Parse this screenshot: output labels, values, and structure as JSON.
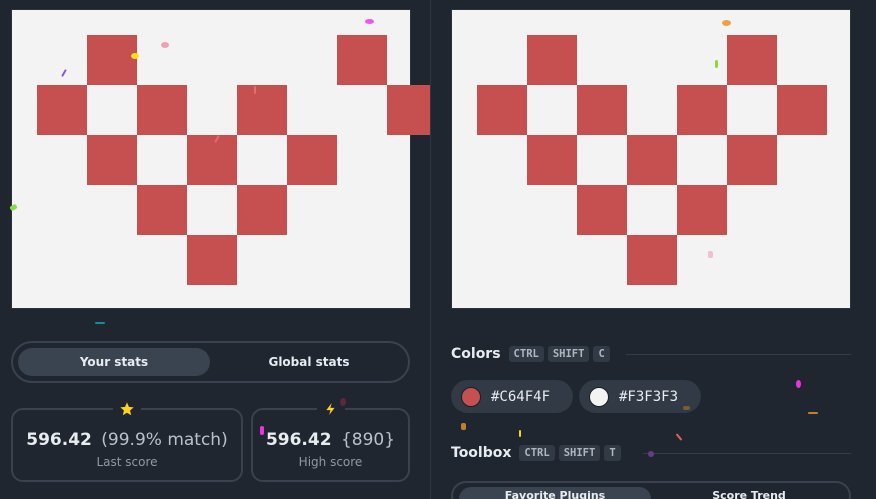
{
  "target_canvas": {
    "background": "#F3F3F3",
    "fill": "#C64F4F",
    "cells": [
      [
        2,
        1
      ],
      [
        7,
        1
      ],
      [
        1,
        2
      ],
      [
        3,
        2
      ],
      [
        5,
        2
      ],
      [
        8,
        2
      ],
      [
        2,
        3
      ],
      [
        4,
        3
      ],
      [
        6,
        3
      ],
      [
        3,
        4
      ],
      [
        5,
        4
      ],
      [
        4,
        5
      ]
    ]
  },
  "output_canvas": {
    "background": "#F3F3F3",
    "fill": "#C64F4F",
    "cells": [
      [
        2,
        1
      ],
      [
        6,
        1
      ],
      [
        1,
        2
      ],
      [
        3,
        2
      ],
      [
        5,
        2
      ],
      [
        7,
        2
      ],
      [
        2,
        3
      ],
      [
        4,
        3
      ],
      [
        6,
        3
      ],
      [
        3,
        4
      ],
      [
        5,
        4
      ],
      [
        4,
        5
      ]
    ]
  },
  "stats_tabs": {
    "your_stats": "Your stats",
    "global_stats": "Global stats"
  },
  "last_score": {
    "icon": "star-icon",
    "value": "596.42",
    "match": "(99.9% match)",
    "label": "Last score"
  },
  "high_score": {
    "icon": "lightning-icon",
    "value": "596.42",
    "count": "{890}",
    "label": "High score"
  },
  "colors_section": {
    "title": "Colors",
    "shortcut": [
      "CTRL",
      "SHIFT",
      "C"
    ],
    "swatches": [
      {
        "hex": "#C64F4F",
        "color": "#C64F4F"
      },
      {
        "hex": "#F3F3F3",
        "color": "#F3F3F3"
      }
    ]
  },
  "toolbox_section": {
    "title": "Toolbox",
    "shortcut": [
      "CTRL",
      "SHIFT",
      "T"
    ],
    "tabs": {
      "favorite_plugins": "Favorite Plugins",
      "score_trend": "Score Trend"
    }
  }
}
